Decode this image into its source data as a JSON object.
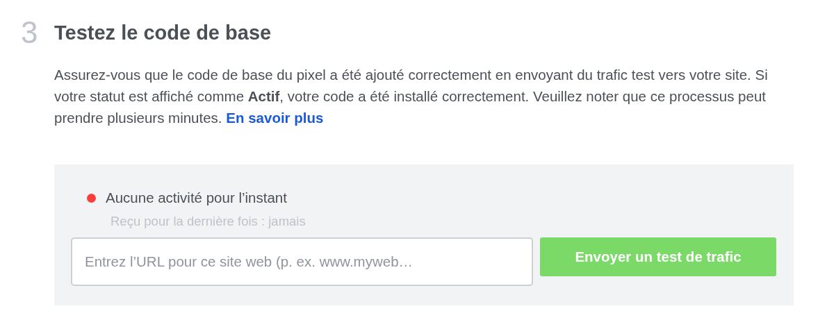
{
  "step": {
    "number": "3",
    "title": "Testez le code de base"
  },
  "description": {
    "text": "Assurez-vous que le code de base du pixel a été ajouté correctement en envoyant du trafic test vers votre site. Si votre statut est affiché comme **Actif**, votre code a été installé correctement. Veuillez noter que ce processus peut prendre plusieurs minutes.",
    "link": "En savoir plus"
  },
  "status": {
    "label": "Aucune activité pour l’instant",
    "color": "#fa3e3e",
    "last_received": "Reçu pour la dernière fois : jamais"
  },
  "url_field": {
    "placeholder": "Entrez l’URL pour ce site web (p. ex. www.myweb…"
  },
  "send_button": {
    "label": "Envoyer un test de trafic",
    "disabled": true
  }
}
